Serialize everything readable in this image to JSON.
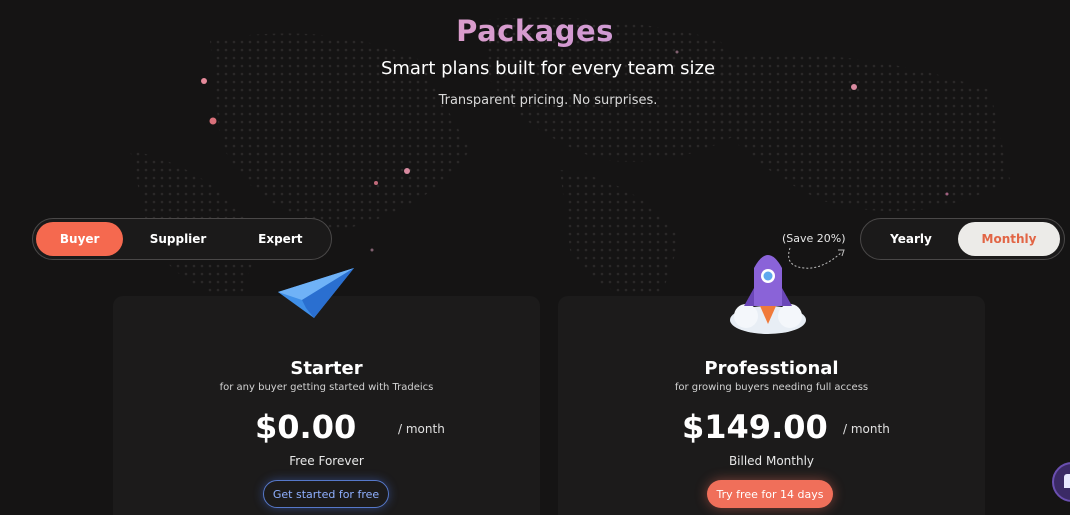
{
  "header": {
    "title": "Packages",
    "subtitle": "Smart plans built for every team size",
    "tagline": "Transparent pricing. No surprises."
  },
  "role_toggle": {
    "options": [
      "Buyer",
      "Supplier",
      "Expert"
    ],
    "selected": "Buyer"
  },
  "period_toggle": {
    "save_note": "(Save 20%)",
    "options": [
      "Yearly",
      "Monthly"
    ],
    "selected": "Monthly"
  },
  "plans": [
    {
      "icon": "paper-plane-icon",
      "name": "Starter",
      "description": "for any buyer getting started with Tradeics",
      "price": "$0.00",
      "period": "/ month",
      "billing": "Free Forever",
      "cta": "Get started for free"
    },
    {
      "icon": "rocket-icon",
      "name": "Professtional",
      "description": "for growing buyers needing full access",
      "price": "$149.00",
      "period": "/ month",
      "billing": "Billed Monthly",
      "cta": "Try free for 14 days"
    }
  ],
  "colors": {
    "background": "#151414",
    "accent": "#f5694f",
    "card": "#1c1b1b",
    "outline_button": "#5678c9"
  }
}
